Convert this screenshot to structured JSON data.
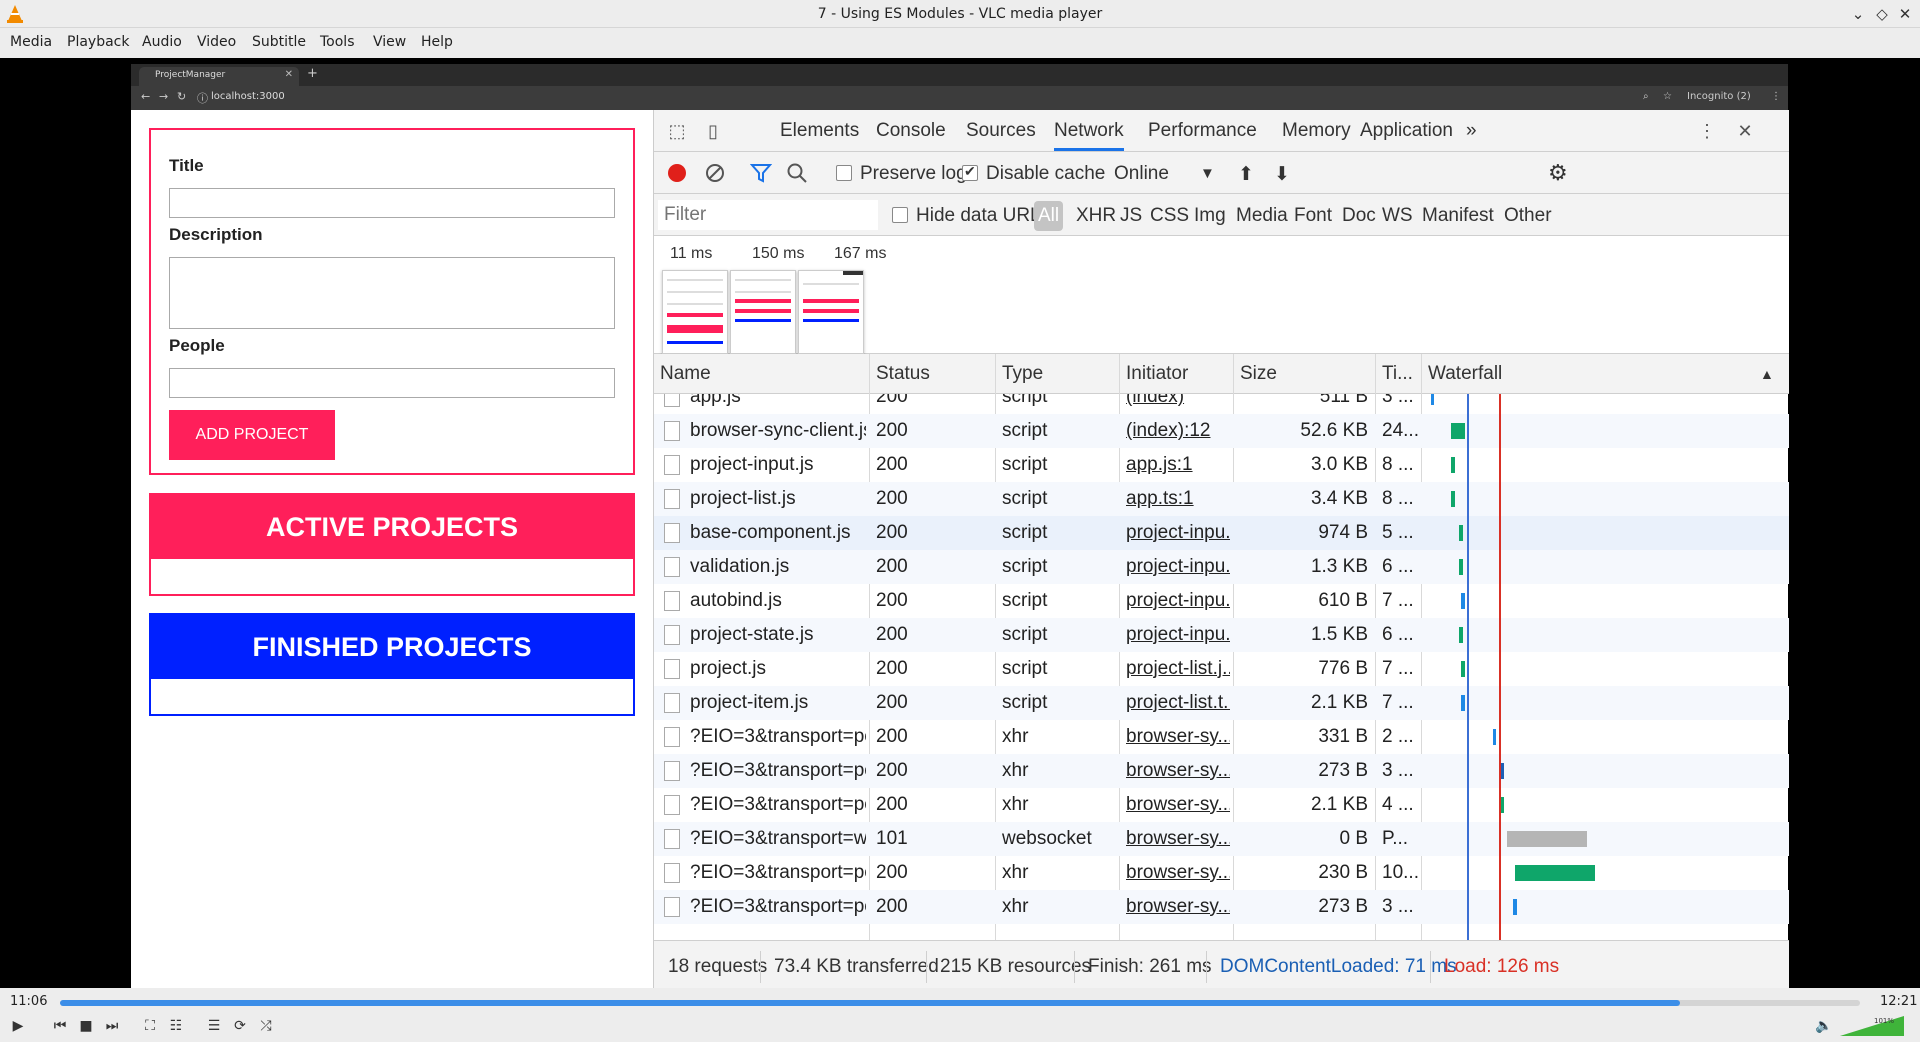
{
  "window": {
    "title": "7 - Using ES Modules - VLC media player"
  },
  "menu": [
    "Media",
    "Playback",
    "Audio",
    "Video",
    "Subtitle",
    "Tools",
    "View",
    "Help"
  ],
  "player": {
    "elapsed": "11:06",
    "total": "12:21",
    "progress": 0.9,
    "volume": "101%"
  },
  "browser": {
    "tab_title": "ProjectManager",
    "url": "localhost:3000",
    "profile": "Incognito (2)"
  },
  "app": {
    "title_label": "Title",
    "description_label": "Description",
    "people_label": "People",
    "add_button": "ADD PROJECT",
    "active_heading": "ACTIVE PROJECTS",
    "finished_heading": "FINISHED PROJECTS",
    "colors": {
      "active": "#ff1f5a",
      "finished": "#0020ff"
    }
  },
  "devtools": {
    "tabs": [
      "Elements",
      "Console",
      "Sources",
      "Network",
      "Performance",
      "Memory",
      "Application"
    ],
    "active_tab": "Network",
    "more": "»",
    "toolbar": {
      "preserve_log": "Preserve log",
      "disable_cache": "Disable cache",
      "throttle": "Online"
    },
    "filter": {
      "placeholder": "Filter",
      "hide_data_urls": "Hide data URLs",
      "types": [
        "All",
        "XHR",
        "JS",
        "CSS",
        "Img",
        "Media",
        "Font",
        "Doc",
        "WS",
        "Manifest",
        "Other"
      ]
    },
    "frames": [
      "11 ms",
      "150 ms",
      "167 ms"
    ],
    "columns": [
      "Name",
      "Status",
      "Type",
      "Initiator",
      "Size",
      "Ti...",
      "Waterfall"
    ],
    "rows": [
      {
        "name": "app.js",
        "status": "200",
        "type": "script",
        "initiator": "(index)",
        "size": "511 B",
        "time": "3 ..."
      },
      {
        "name": "browser-sync-client.js...",
        "status": "200",
        "type": "script",
        "initiator": "(index):12",
        "size": "52.6 KB",
        "time": "24..."
      },
      {
        "name": "project-input.js",
        "status": "200",
        "type": "script",
        "initiator": "app.js:1",
        "size": "3.0 KB",
        "time": "8 ..."
      },
      {
        "name": "project-list.js",
        "status": "200",
        "type": "script",
        "initiator": "app.ts:1",
        "size": "3.4 KB",
        "time": "8 ..."
      },
      {
        "name": "base-component.js",
        "status": "200",
        "type": "script",
        "initiator": "project-inpu...",
        "size": "974 B",
        "time": "5 ..."
      },
      {
        "name": "validation.js",
        "status": "200",
        "type": "script",
        "initiator": "project-inpu...",
        "size": "1.3 KB",
        "time": "6 ..."
      },
      {
        "name": "autobind.js",
        "status": "200",
        "type": "script",
        "initiator": "project-inpu...",
        "size": "610 B",
        "time": "7 ..."
      },
      {
        "name": "project-state.js",
        "status": "200",
        "type": "script",
        "initiator": "project-inpu...",
        "size": "1.5 KB",
        "time": "6 ..."
      },
      {
        "name": "project.js",
        "status": "200",
        "type": "script",
        "initiator": "project-list.j...",
        "size": "776 B",
        "time": "7 ..."
      },
      {
        "name": "project-item.js",
        "status": "200",
        "type": "script",
        "initiator": "project-list.t...",
        "size": "2.1 KB",
        "time": "7 ..."
      },
      {
        "name": "?EIO=3&transport=poll...",
        "status": "200",
        "type": "xhr",
        "initiator": "browser-sy...",
        "size": "331 B",
        "time": "2 ..."
      },
      {
        "name": "?EIO=3&transport=poll...",
        "status": "200",
        "type": "xhr",
        "initiator": "browser-sy...",
        "size": "273 B",
        "time": "3 ..."
      },
      {
        "name": "?EIO=3&transport=poll...",
        "status": "200",
        "type": "xhr",
        "initiator": "browser-sy...",
        "size": "2.1 KB",
        "time": "4 ..."
      },
      {
        "name": "?EIO=3&transport=we...",
        "status": "101",
        "type": "websocket",
        "initiator": "browser-sy...",
        "size": "0 B",
        "time": "P..."
      },
      {
        "name": "?EIO=3&transport=poll...",
        "status": "200",
        "type": "xhr",
        "initiator": "browser-sy...",
        "size": "230 B",
        "time": "10..."
      },
      {
        "name": "?EIO=3&transport=poll...",
        "status": "200",
        "type": "xhr",
        "initiator": "browser-sy...",
        "size": "273 B",
        "time": "3 ..."
      }
    ],
    "status": {
      "requests": "18 requests",
      "transferred": "73.4 KB transferred",
      "resources": "215 KB resources",
      "finish": "Finish: 261 ms",
      "dcl": "DOMContentLoaded: 71 ms",
      "load": "Load: 126 ms"
    }
  }
}
